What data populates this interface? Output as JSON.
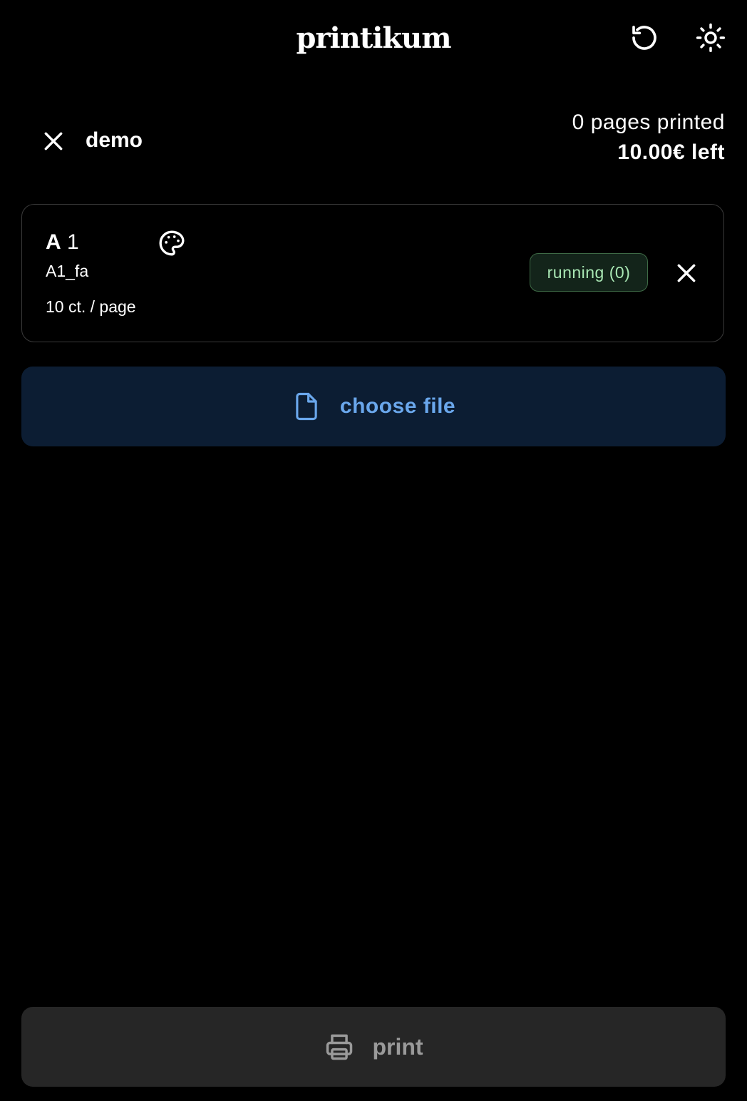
{
  "header": {
    "brand": "printikum",
    "reset_icon": "rotate-ccw-icon",
    "theme_icon": "sun-icon"
  },
  "account": {
    "logout_icon": "close-icon",
    "username": "demo",
    "pages_printed": "0 pages printed",
    "balance": "10.00€ left"
  },
  "printer": {
    "name_letter": "A",
    "name_number": "1",
    "color_icon": "palette-icon",
    "id": "A1_fa",
    "price": "10 ct. / page",
    "status": "running (0)",
    "status_color": "#a9e7b4",
    "remove_icon": "close-icon"
  },
  "file": {
    "icon": "file-icon",
    "label": "choose file",
    "accent": "#6aa7ec"
  },
  "print": {
    "icon": "printer-icon",
    "label": "print"
  }
}
